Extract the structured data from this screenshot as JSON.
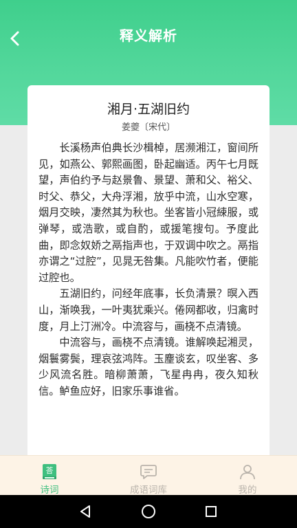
{
  "header": {
    "title": "释义解析",
    "back_icon": "chevron-left-icon",
    "color_top": "#3fcf8c",
    "color_bottom": "#5fdca6"
  },
  "poem": {
    "title": "湘月·五湖旧约",
    "author": "姜夔〔宋代〕",
    "paragraphs": [
      "长溪杨声伯典长沙楫棹，居濒湘江，窗间所见，如燕公、郭熙画图，卧起幽适。丙午七月既望，声伯约予与赵景鲁、景望、萧和父、裕父、时父、恭父，大舟浮湘，放乎中流，山水空寒，烟月交映，凄然其为秋也。坐客皆小冠綀服，或弹琴，或浩歌，或自酌，或援笔搜句。予度此曲，即念奴娇之鬲指声也，于双调中吹之。鬲指亦谓之“过腔”，见晁无咎集。凡能吹竹者，便能过腔也。",
      "五湖旧约，问经年底事，长负清景？暝入西山，渐唤我，一叶夷犹乘兴。倦网都收，归禽时度，月上汀洲冷。中流容与，画桡不点清镜。",
      "中流容与，画桡不点清镜。谁解唤起湘灵，烟鬟雾鬓，理哀弦鸿阵。玉麈谈玄，叹坐客、多少风流名胜。暗柳萧萧，飞星冉冉，夜久知秋信。鲈鱼应好，旧家乐事谁省。"
    ]
  },
  "tabbar": {
    "active_color": "#3fbf7f",
    "inactive_color": "#b9b3ab",
    "items": [
      {
        "label": "诗词",
        "icon": "poetry-book-icon",
        "active": true
      },
      {
        "label": "成语词库",
        "icon": "chat-bubble-icon",
        "active": false
      },
      {
        "label": "我的",
        "icon": "person-icon",
        "active": false
      }
    ]
  },
  "system_nav": {
    "back_icon": "triangle-back-icon",
    "home_icon": "circle-home-icon",
    "recents_icon": "square-recents-icon"
  }
}
